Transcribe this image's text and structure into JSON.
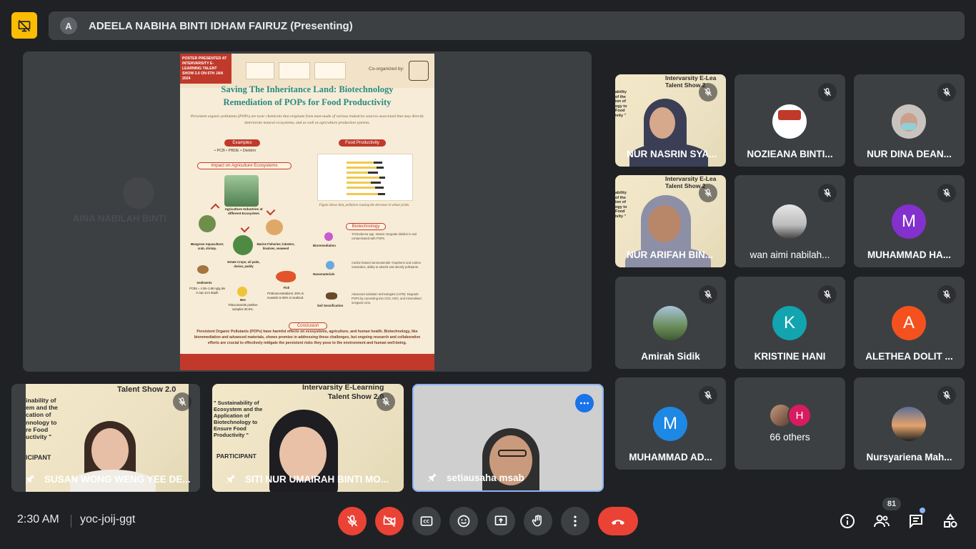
{
  "banner": {
    "avatar_letter": "A",
    "presenting_text": "ADEELA NABIHA BINTI IDHAM FAIRUZ (Presenting)"
  },
  "stage": {
    "ghost_name": "AINA NABILAH BINTI"
  },
  "poster": {
    "tag": "POSTER PRESENTED AT INTERVARSITY E-LEARNING TALENT SHOW 2.0 ON 6TH JAN 2024",
    "co_organized": "Co-organized by:",
    "title_line1": "Saving The Inheritance Land: Biotechnology",
    "title_line2": "Remediation of POPs for Food Productivity",
    "intro": "Persistent organic pollutants (POPs) are toxic chemicals that originate from man-made of various industries sources associated that may directly deteriorate natural ecosystems, and as well as agriculture production systems.",
    "examples_label": "Examples",
    "examples_list": "•  PCB     •  PBDE     •  Dieldrin",
    "food_label": "Food Productivity",
    "impact_label": "Impact on Agriculture Ecosystems",
    "forest_label": "Agriculture Industries at different Ecosystem",
    "mangrove_label": "Mangrove Aquaculture; crab, shrimp.",
    "marine_label": "Marine Fisheries; lobsters, bivalves, seaweed",
    "estate_label": "Estate Crops; oil palm, durian, paddy",
    "sediments_label": "Sediments",
    "sediments_text": "PCBs = 4.36–1.86 ng/g dw in top 1cm depth",
    "fish_label": "Fish",
    "fish_text": "PCBconcentrations: 46% in mussels to 88% in seafood.",
    "bee_label": "Bee",
    "bee_text": "Tebuconazole positive samples 30.6%.",
    "soil_label": "Soil Sensification",
    "chart_caption": "Figure shows that, pollution causing the decrease in wheat yields.",
    "biotech_label": "Biotechnology",
    "bio1_label": "Bioremediation",
    "bio1_text": "Trichoderma spp. strains: Degrade dieldrin in soil contaminated with POPs.",
    "bio2_label": "Nanomaterials",
    "bio2_text": "Carbon-based nanomaterials: Graphene and carbon nanotubes, ability to absorb and densify pollutants.",
    "bio3_text": "Advanced oxidation technologies (AOTs): Degrade POPs by converting into CO2, H2O, and mineralised inorganic ions.",
    "conclusion_label": "Conclusion",
    "conclusion_text": "Persistent Organic Pollutants (POPs) have harmful effects on ecosystems, agriculture, and human health. Biotechnology, like bioremediation and advanced materials, shows promise in addressing these challenges, but ongoing research and collaborative efforts are crucial to effectively mitigate the persistent risks they pose to the environment and human well-being."
  },
  "participants": [
    {
      "name": "NUR NASRIN SYA..."
    },
    {
      "name": "NOZIEANA BINTI..."
    },
    {
      "name": "NUR DINA DEAN..."
    },
    {
      "name": "NUR ARIFAH BIN..."
    },
    {
      "name": "wan aimi nabilah..."
    },
    {
      "name": "MUHAMMAD HA...",
      "letter": "M"
    },
    {
      "name": "Amirah Sidik"
    },
    {
      "name": "KRISTINE HANI",
      "letter": "K"
    },
    {
      "name": "ALETHEA DOLIT ...",
      "letter": "A"
    },
    {
      "name": "MUHAMMAD AD...",
      "letter": "M"
    },
    {
      "name": "66 others",
      "letter": "H"
    },
    {
      "name": "Nursyariena Mah..."
    }
  ],
  "bottom_tiles": [
    {
      "name": "SUSAN WONG WENG YEE DE...",
      "poster_text": "Talent Show 2.0",
      "side_text": "inability of\nem and the\ncation of\nnnology to\nre Food\nuctivity \"",
      "label": "ICIPANT"
    },
    {
      "name": "SITI NUR UMAIRAH BINTI MO...",
      "poster_text": "Intervarsity E-Learning\nTalent Show 2.0",
      "side_text": "\" Sustainability of\nEcosystem and the\nApplication of\nBiotechnology to\nEnsure Food\nProductivity \"",
      "label": "PARTICIPANT"
    },
    {
      "name": "setiausaha msab"
    }
  ],
  "tile_poster_text": "Intervarsity E-Lea\nTalent Show 2",
  "tile_side_text": "ability\nof the\nion of\nogy to\nFood\nivity \"",
  "bottom_bar": {
    "time": "2:30 AM",
    "meeting_code": "yoc-joij-ggt",
    "people_count": "81"
  },
  "colors": {
    "background": "#202124",
    "tile": "#3c4043",
    "danger": "#ea4335",
    "accent": "#1a73e8",
    "present_badge": "#fbbc04"
  }
}
